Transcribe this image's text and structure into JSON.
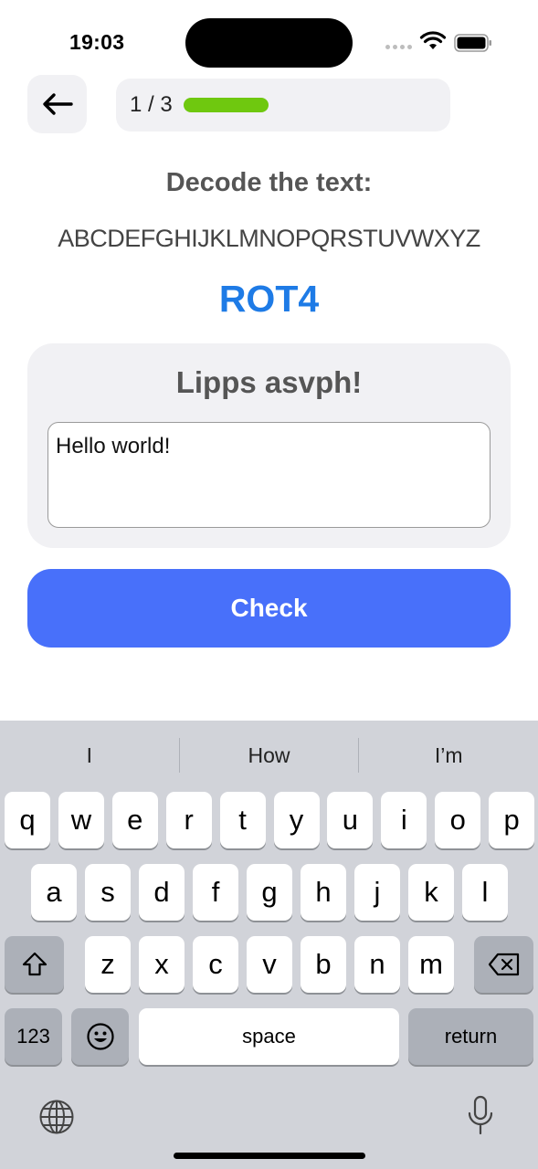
{
  "status": {
    "time": "19:03"
  },
  "header": {
    "progress_text": "1 / 3",
    "progress_fraction": 0.36
  },
  "quiz": {
    "prompt": "Decode the text:",
    "alphabet": "ABCDEFGHIJKLMNOPQRSTUVWXYZ",
    "cipher": "ROT4",
    "encoded_text": "Lipps asvph!",
    "answer_value": "Hello world!",
    "check_label": "Check"
  },
  "keyboard": {
    "suggestions": [
      "I",
      "How",
      "I’m"
    ],
    "row1": [
      "q",
      "w",
      "e",
      "r",
      "t",
      "y",
      "u",
      "i",
      "o",
      "p"
    ],
    "row2": [
      "a",
      "s",
      "d",
      "f",
      "g",
      "h",
      "j",
      "k",
      "l"
    ],
    "row3": [
      "z",
      "x",
      "c",
      "v",
      "b",
      "n",
      "m"
    ],
    "numbers_label": "123",
    "space_label": "space",
    "return_label": "return"
  },
  "colors": {
    "accent": "#4870fa",
    "cipher": "#1e7be6",
    "progress": "#6fc80f"
  }
}
